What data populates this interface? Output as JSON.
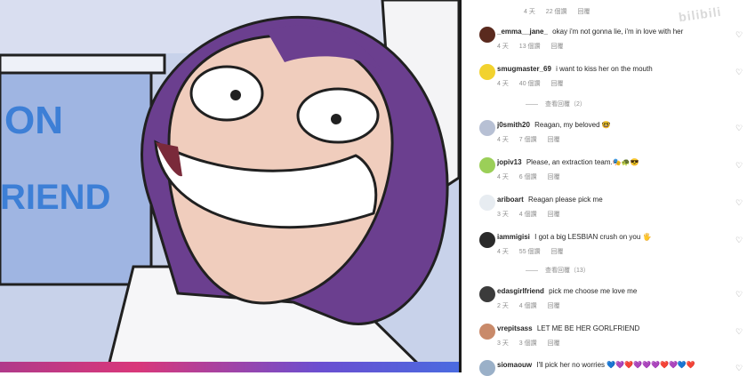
{
  "art": {
    "sign_text_1": "ON",
    "sign_text_2": "RIEND"
  },
  "watermark": "bilibili",
  "top_meta": {
    "age": "4 天",
    "likes": "22 個讚",
    "reply": "回覆"
  },
  "comments": [
    {
      "user": "_emma__jane_",
      "text": "okay i'm not gonna lie, i'm in love with her",
      "age": "4 天",
      "likes": "13 個讚",
      "reply": "回覆",
      "avatar_color": "#5a2a1e"
    },
    {
      "user": "smugmaster_69",
      "text": "i want to kiss her on the mouth",
      "age": "4 天",
      "likes": "40 個讚",
      "reply": "回覆",
      "view_replies": "查看回覆（2）",
      "avatar_color": "#f2d22e"
    },
    {
      "user": "j0smith20",
      "text": "Reagan, my beloved 🤓",
      "age": "4 天",
      "likes": "7 個讚",
      "reply": "回覆",
      "avatar_color": "#b7c0d4"
    },
    {
      "user": "jopiv13",
      "text": "Please, an extraction team.🎭🐢😎",
      "age": "4 天",
      "likes": "6 個讚",
      "reply": "回覆",
      "avatar_color": "#9bcf58"
    },
    {
      "user": "ariboart",
      "text": "Reagan please pick me",
      "age": "3 天",
      "likes": "4 個讚",
      "reply": "回覆",
      "avatar_color": "#e7ecf1"
    },
    {
      "user": "iammigisi",
      "text": "I got a big LESBIAN crush on you 🖐",
      "age": "4 天",
      "likes": "55 個讚",
      "reply": "回覆",
      "view_replies": "查看回覆（13）",
      "avatar_color": "#2a2a2a"
    },
    {
      "user": "edasgirlfriend",
      "text": "pick me choose me love me",
      "age": "2 天",
      "likes": "4 個讚",
      "reply": "回覆",
      "avatar_color": "#3b3b3b"
    },
    {
      "user": "vrepitsass",
      "text": "LET ME BE HER GORLFRIEND",
      "age": "3 天",
      "likes": "3 個讚",
      "reply": "回覆",
      "avatar_color": "#c98a6a"
    },
    {
      "user": "siomaouw",
      "text": "I'll pick her no worries 💙💜❤️💜💜💜❤️💜💙❤️",
      "age": "",
      "likes": "",
      "reply": "",
      "avatar_color": "#9ab0c8"
    }
  ],
  "icons": {
    "heart": "heart-outline-icon"
  }
}
